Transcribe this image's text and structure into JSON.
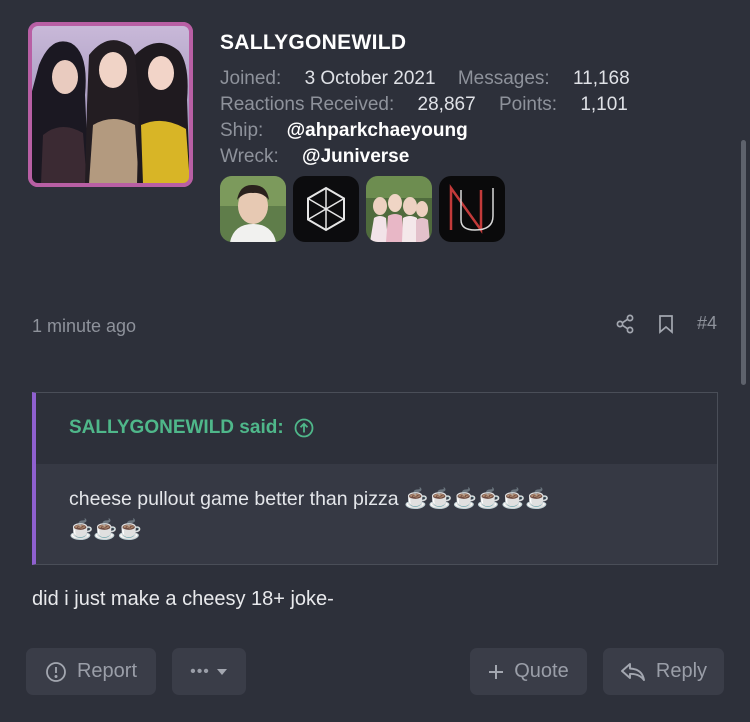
{
  "user": {
    "username": "SALLYGONEWILD",
    "joined_label": "Joined:",
    "joined_value": "3 October 2021",
    "messages_label": "Messages:",
    "messages_value": "11,168",
    "reactions_label": "Reactions Received:",
    "reactions_value": "28,867",
    "points_label": "Points:",
    "points_value": "1,101",
    "ship_label": "Ship:",
    "ship_value": "@ahparkchaeyoung",
    "wreck_label": "Wreck:",
    "wreck_value": "@Juniverse",
    "badges": [
      "person-portrait-badge",
      "hexagon-logo-badge",
      "group-photo-badge",
      "nu-logo-badge"
    ]
  },
  "post": {
    "time": "1 minute ago",
    "number": "#4",
    "quote_author": "SALLYGONEWILD said:",
    "quote_text": "cheese pullout game better than pizza ☕☕☕☕☕☕",
    "quote_text_cont": "☕☕☕",
    "reply_text": "did i just make a cheesy 18+ joke-"
  },
  "actions": {
    "report": "Report",
    "more": "•••",
    "quote": "Quote",
    "reply": "Reply"
  },
  "colors": {
    "background": "#2d303a",
    "quote_accent": "#8f60cf",
    "quote_author": "#4fb78a",
    "button_bg": "#3a3d48"
  }
}
